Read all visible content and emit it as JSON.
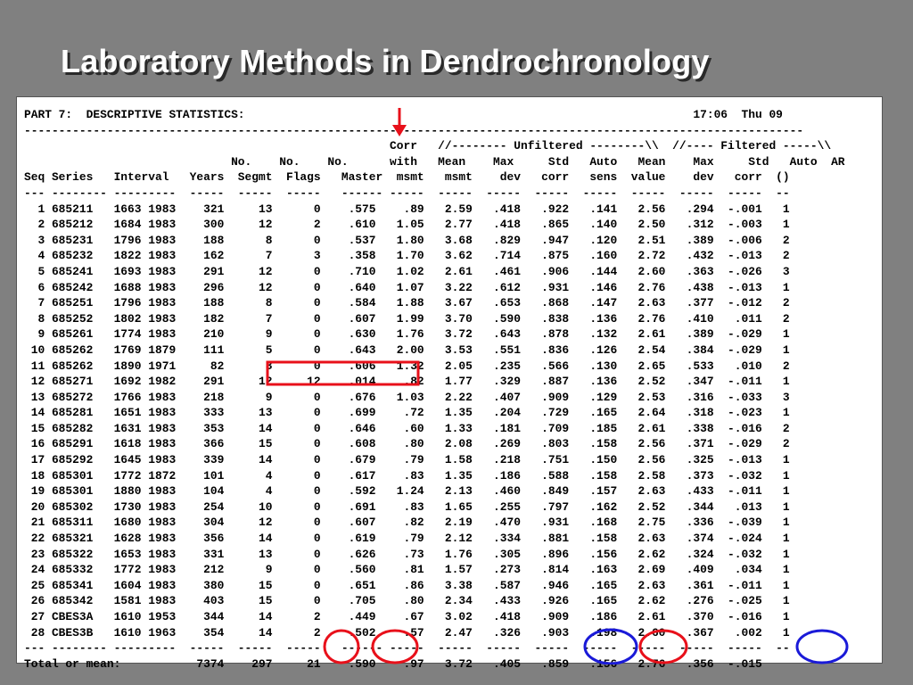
{
  "slide": {
    "title": "Laboratory Methods in Dendrochronology"
  },
  "printout": {
    "lines": [
      "PART 7:  DESCRIPTIVE STATISTICS:                                                                 17:06  Thu 09",
      "-----------------------------------------------------------------------------------------------------------------",
      "                                                     Corr   //-------- Unfiltered --------\\\\  //---- Filtered -----\\\\",
      "                              No.    No.    No.      with   Mean    Max     Std   Auto   Mean    Max     Std   Auto  AR",
      "Seq Series   Interval   Years  Segmt  Flags   Master  msmt   msmt    dev   corr   sens  value    dev   corr  ()",
      "--- -------- ---------  -----  -----  -----   ------ -----  -----  -----  -----  -----  -----  -----  -----  --",
      "  1 685211   1663 1983    321     13      0    .575    .89   2.59   .418   .922   .141   2.56   .294  -.001   1",
      "  2 685212   1684 1983    300     12      2    .610   1.05   2.77   .418   .865   .140   2.50   .312  -.003   1",
      "  3 685231   1796 1983    188      8      0    .537   1.80   3.68   .829   .947   .120   2.51   .389  -.006   2",
      "  4 685232   1822 1983    162      7      3    .358   1.70   3.62   .714   .875   .160   2.72   .432  -.013   2",
      "  5 685241   1693 1983    291     12      0    .710   1.02   2.61   .461   .906   .144   2.60   .363  -.026   3",
      "  6 685242   1688 1983    296     12      0    .640   1.07   3.22   .612   .931   .146   2.76   .438  -.013   1",
      "  7 685251   1796 1983    188      8      0    .584   1.88   3.67   .653   .868   .147   2.63   .377  -.012   2",
      "  8 685252   1802 1983    182      7      0    .607   1.99   3.70   .590   .838   .136   2.76   .410   .011   2",
      "  9 685261   1774 1983    210      9      0    .630   1.76   3.72   .643   .878   .132   2.61   .389  -.029   1",
      " 10 685262   1769 1879    111      5      0    .643   2.00   3.53   .551   .836   .126   2.54   .384  -.029   1",
      " 11 685262   1890 1971     82      3      0    .606   1.32   2.05   .235   .566   .130   2.65   .533   .010   2",
      " 12 685271   1692 1982    291     12     12    .014    .82   1.77   .329   .887   .136   2.52   .347  -.011   1",
      " 13 685272   1766 1983    218      9      0    .676   1.03   2.22   .407   .909   .129   2.53   .316  -.033   3",
      " 14 685281   1651 1983    333     13      0    .699    .72   1.35   .204   .729   .165   2.64   .318  -.023   1",
      " 15 685282   1631 1983    353     14      0    .646    .60   1.33   .181   .709   .185   2.61   .338  -.016   2",
      " 16 685291   1618 1983    366     15      0    .608    .80   2.08   .269   .803   .158   2.56   .371  -.029   2",
      " 17 685292   1645 1983    339     14      0    .679    .79   1.58   .218   .751   .150   2.56   .325  -.013   1",
      " 18 685301   1772 1872    101      4      0    .617    .83   1.35   .186   .588   .158   2.58   .373  -.032   1",
      " 19 685301   1880 1983    104      4      0    .592   1.24   2.13   .460   .849   .157   2.63   .433  -.011   1",
      " 20 685302   1730 1983    254     10      0    .691    .83   1.65   .255   .797   .162   2.52   .344   .013   1",
      " 21 685311   1680 1983    304     12      0    .607    .82   2.19   .470   .931   .168   2.75   .336  -.039   1",
      " 22 685321   1628 1983    356     14      0    .619    .79   2.12   .334   .881   .158   2.63   .374  -.024   1",
      " 23 685322   1653 1983    331     13      0    .626    .73   1.76   .305   .896   .156   2.62   .324  -.032   1",
      " 24 685332   1772 1983    212      9      0    .560    .81   1.57   .273   .814   .163   2.69   .409   .034   1",
      " 25 685341   1604 1983    380     15      0    .651    .86   3.38   .587   .946   .165   2.63   .361  -.011   1",
      " 26 685342   1581 1983    403     15      0    .705    .80   2.34   .433   .926   .165   2.62   .276  -.025   1",
      " 27 CBES3A   1610 1953    344     14      2    .449    .67   3.02   .418   .909   .186   2.61   .370  -.016   1",
      " 28 CBES3B   1610 1963    354     14      2    .502    .57   2.47   .326   .903   .198   2.60   .367   .002   1",
      "--- -------- ---------  -----  -----  -----   ------ -----  -----  -----  -----  -----  -----  -----  -----  --",
      "Total or mean:           7374    297     21    .590    .97   3.72   .405   .859   .156   2.76   .356  -.015"
    ]
  },
  "annotations": {
    "red_color": "#e8101a",
    "blue_color": "#1a1ad8"
  }
}
